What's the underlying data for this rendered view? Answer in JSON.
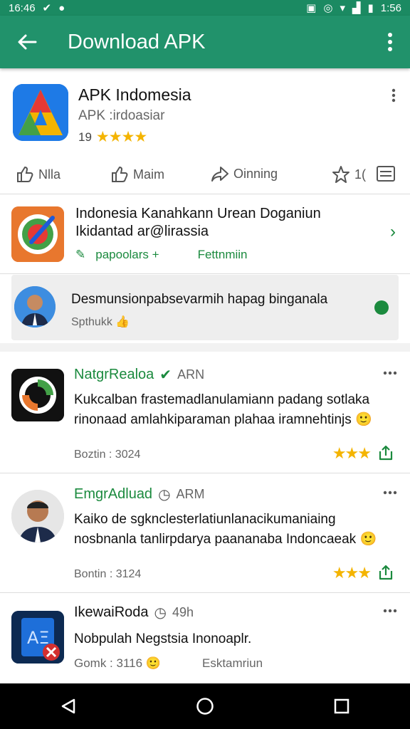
{
  "status_bar": {
    "time_left": "16:46",
    "time_right": "1:56"
  },
  "app_bar": {
    "title": "Download APK"
  },
  "app": {
    "name": "APK Indomesia",
    "subtitle": "APK :irdoasiar",
    "rating_count": "19",
    "stars": "★★★★",
    "actions": [
      "Nlla",
      "Maim",
      "Oinning",
      "1("
    ]
  },
  "promo": {
    "title": "Indonesia Kanahkann Urean Doganiun Ikidantad ar@lirassia",
    "meta_left": "papoolars +",
    "meta_right": "Fettnmiin"
  },
  "notice": {
    "text": "Desmunsionpabsevarmih hapag binganala",
    "sub": "Spthukk"
  },
  "reviews": [
    {
      "name": "NatgrRealoa",
      "time": "ARN",
      "body": "Kukcalban frastemadlanulamiann padang sotlaka rinonaad amlahkiparaman plahaa iramnehtinjs",
      "date": "Boztin : 3024",
      "stars": "★★★"
    },
    {
      "name": "EmgrAdluad",
      "time": "ARM",
      "body": "Kaiko de sgknclesterlatiunlanacikumaniaing nosbnanla tanlirpdarya paananaba Indoncaeak",
      "date": "Bontin : 3124",
      "stars": "★★★"
    },
    {
      "name": "IkewaiRoda",
      "time": "49h",
      "body": "Nobpulah Negstsia Inonoaplr.",
      "date": "Gomk : 3116",
      "extra": "Esktamriun"
    }
  ],
  "colors": {
    "primary": "#21926b",
    "accent_green": "#1b8a3e",
    "star": "#f4b400"
  }
}
